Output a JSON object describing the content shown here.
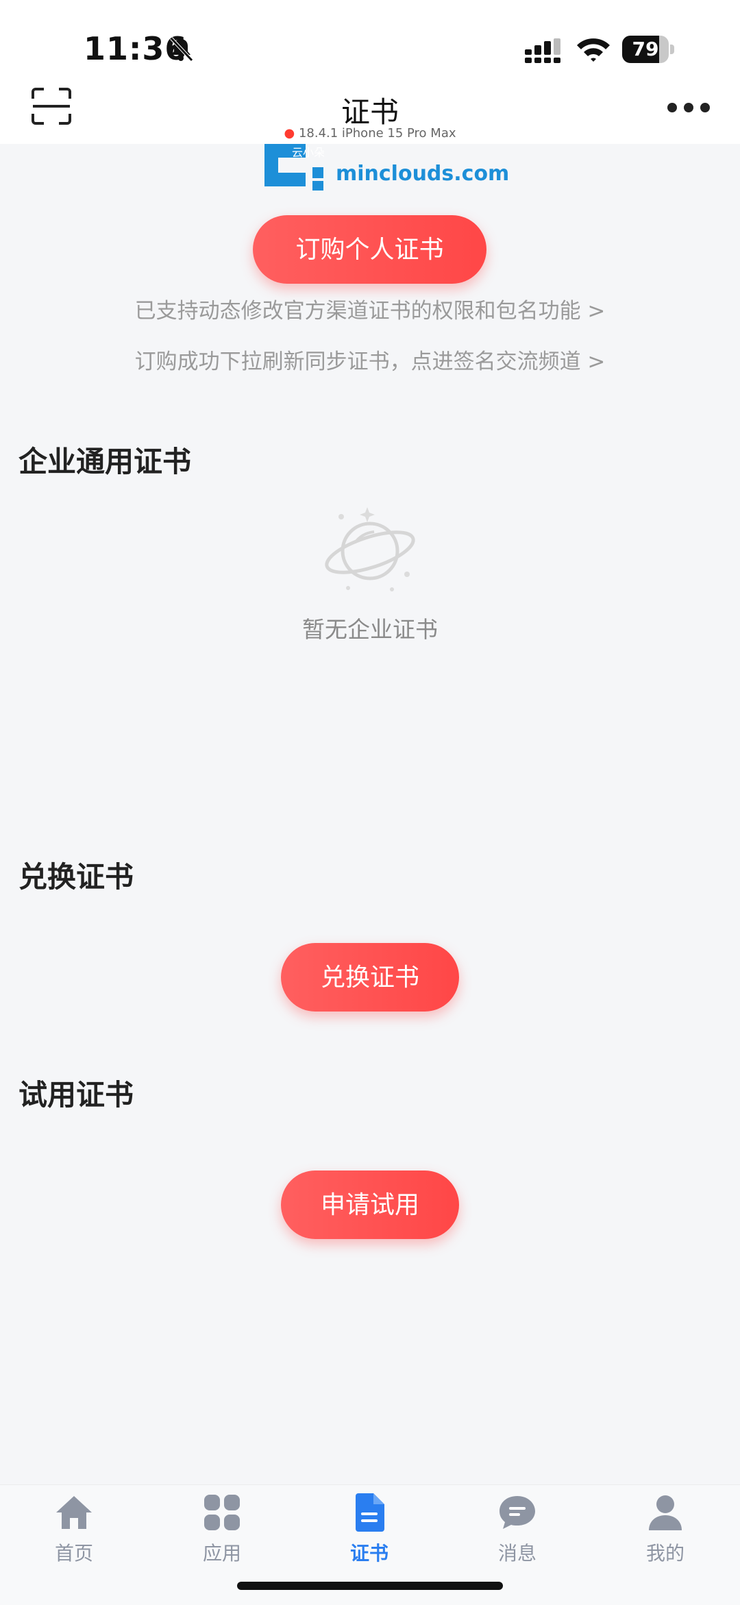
{
  "status_bar": {
    "time": "11:36",
    "battery": "79",
    "battery_level": 0.79,
    "icons": [
      "bell-slash-icon",
      "signal-icon",
      "wifi-icon",
      "battery-icon"
    ]
  },
  "nav": {
    "title": "证书",
    "device_info": "18.4.1 iPhone 15 Pro Max",
    "left_icon": "scan-icon",
    "right_icon": "more-icon"
  },
  "logo": {
    "brand_small": "云小朵",
    "domain": "minclouds.com"
  },
  "personal": {
    "buy_button": "订购个人证书",
    "link1": "已支持动态修改官方渠道证书的权限和包名功能 >",
    "link2": "订购成功下拉刷新同步证书，点进签名交流频道 >"
  },
  "enterprise": {
    "title": "企业通用证书",
    "empty_text": "暂无企业证书",
    "empty_icon": "planet-icon"
  },
  "redeem": {
    "title": "兑换证书",
    "button": "兑换证书"
  },
  "trial": {
    "title": "试用证书",
    "button": "申请试用"
  },
  "tabbar": {
    "items": [
      {
        "label": "首页",
        "icon": "home-icon"
      },
      {
        "label": "应用",
        "icon": "apps-icon"
      },
      {
        "label": "证书",
        "icon": "document-icon",
        "active": true
      },
      {
        "label": "消息",
        "icon": "chat-icon"
      },
      {
        "label": "我的",
        "icon": "user-icon"
      }
    ]
  },
  "colors": {
    "accent_red": "#ff4d4f",
    "tab_active": "#2a7ef0",
    "tab_inactive": "#8e95a3",
    "background": "#f5f6f8"
  }
}
